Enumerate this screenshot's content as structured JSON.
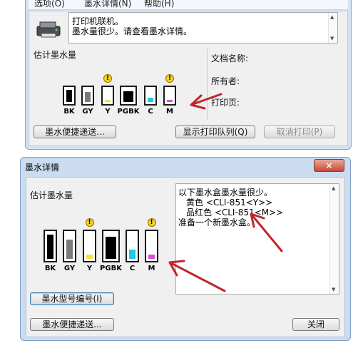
{
  "printer_window": {
    "menu": [
      "选项(O)",
      "墨水详情(N)",
      "帮助(H)"
    ],
    "status_lines": [
      "打印机联机。",
      "墨水量很少。请查看墨水详情。"
    ],
    "ink_heading": "估计墨水量",
    "doc_fields": {
      "doc_name": "文档名称:",
      "owner": "所有者:",
      "pages": "打印页:"
    },
    "buttons": {
      "ink_delivery": "墨水便捷递送...",
      "show_queue": "显示打印队列(Q)",
      "cancel_print": "取消打印(P)"
    }
  },
  "inks": [
    {
      "label": "BK",
      "color": "#000000",
      "level": 0.95,
      "warning": false
    },
    {
      "label": "GY",
      "color": "#7a7a7a",
      "level": 0.75,
      "warning": false
    },
    {
      "label": "Y",
      "color": "#f2e23a",
      "level": 0.18,
      "warning": true
    },
    {
      "label": "PGBK",
      "color": "#000000",
      "level": 0.85,
      "warning": false
    },
    {
      "label": "C",
      "color": "#1ec8e6",
      "level": 0.35,
      "warning": false
    },
    {
      "label": "M",
      "color": "#d84fd8",
      "level": 0.18,
      "warning": true
    }
  ],
  "ink_window": {
    "title": "墨水详情",
    "close_label": "×",
    "ink_heading": "估计墨水量",
    "details": [
      "以下墨水盒墨水量很少。",
      "黄色 <CLI-851<Y>>",
      "品红色 <CLI-851<M>>",
      "准备一个新墨水盒。"
    ],
    "buttons": {
      "model_number": "墨水型号编号(I)",
      "ink_delivery": "墨水便捷递送...",
      "close": "关闭"
    }
  },
  "colors": {
    "annotation_arrow": "#c0262b",
    "warning": "#f7d21c"
  }
}
